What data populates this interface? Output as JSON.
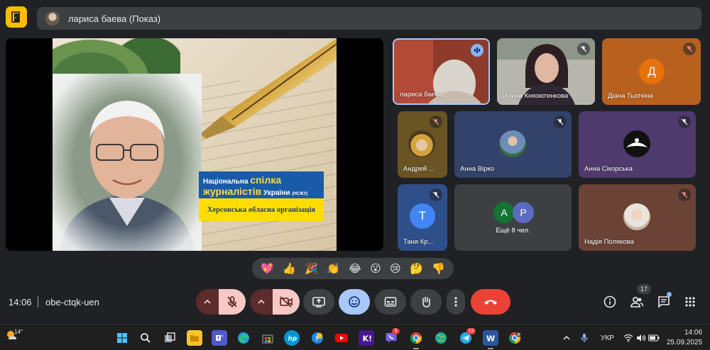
{
  "header": {
    "presenter_label": "лариса баева (Показ)"
  },
  "slide": {
    "union_line1_prefix": "Національна ",
    "union_line1_strong": "спілка",
    "union_line2_strong": "журналістів",
    "union_line2_suffix": " України ",
    "union_abbrev": "(НСЖУ)",
    "organization": "Херсонська обласна організація"
  },
  "participants": [
    {
      "name": "лариса баева",
      "state": "speaking"
    },
    {
      "name": "Ирина Князютенкова",
      "state": "muted"
    },
    {
      "name": "Діана Тьоткіна",
      "state": "muted",
      "initial": "Д",
      "avatar_color": "#e8710a"
    },
    {
      "name": "Андрей ...",
      "state": "muted"
    },
    {
      "name": "Анна Вірко",
      "state": "muted"
    },
    {
      "name": "Анна Сікорська",
      "state": "muted"
    },
    {
      "name": "Таня Кр...",
      "state": "muted",
      "initial": "T",
      "avatar_color": "#4285f4"
    },
    {
      "name": "Ещё 8 чел.",
      "initials": [
        "A",
        "P"
      ],
      "avatar_colors": [
        "#137333",
        "#5c6bc0"
      ]
    },
    {
      "name": "Надія Полякова",
      "state": "muted"
    }
  ],
  "reactions": [
    "💖",
    "👍",
    "🎉",
    "👏",
    "😂",
    "😮",
    "😢",
    "🤔",
    "👎"
  ],
  "footer": {
    "time": "14:06",
    "meeting_code": "obe-ctqk-uen",
    "people_count": "17"
  },
  "controls": [
    {
      "name": "mic-options",
      "icon": "chevron-up-icon"
    },
    {
      "name": "mic-toggle",
      "icon": "mic-off-icon"
    },
    {
      "name": "camera-options",
      "icon": "chevron-up-icon"
    },
    {
      "name": "camera-toggle",
      "icon": "camera-off-icon"
    },
    {
      "name": "present",
      "icon": "present-screen-icon"
    },
    {
      "name": "reactions",
      "icon": "emoji-icon"
    },
    {
      "name": "captions",
      "icon": "captions-icon"
    },
    {
      "name": "raise-hand",
      "icon": "hand-icon"
    },
    {
      "name": "more-options",
      "icon": "more-vert-icon"
    },
    {
      "name": "leave-call",
      "icon": "hang-up-icon"
    }
  ],
  "taskbar": {
    "weather_temp": "14°",
    "lang": "УКР",
    "clock_time": "14:06",
    "clock_date": "25.09.2025",
    "badges": {
      "viber": "5",
      "telegram": "19"
    }
  },
  "colors": {
    "background": "#202124",
    "surface": "#3c4043",
    "accent_blue": "#8ab4f8",
    "end_call": "#ea4335",
    "muted_red": "#f6c9c5"
  }
}
